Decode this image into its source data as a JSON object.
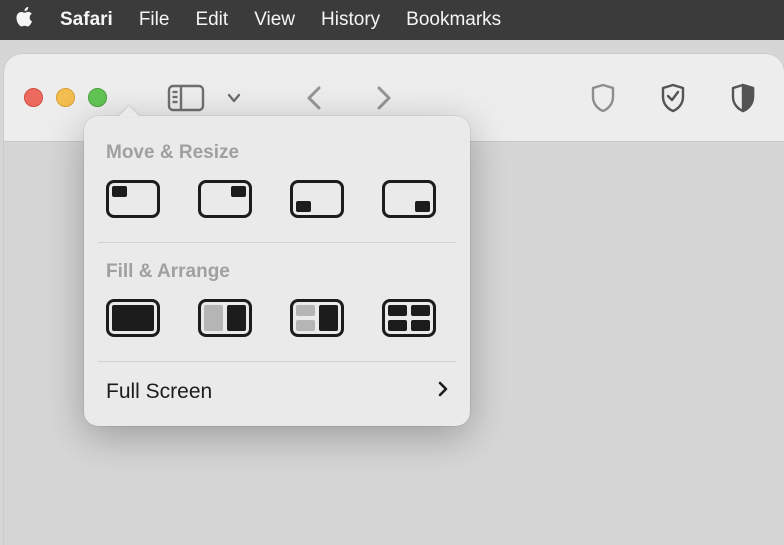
{
  "menubar": {
    "items": [
      "Safari",
      "File",
      "Edit",
      "View",
      "History",
      "Bookmarks"
    ]
  },
  "popover": {
    "section1_label": "Move & Resize",
    "section2_label": "Fill & Arrange",
    "full_screen_label": "Full Screen"
  }
}
